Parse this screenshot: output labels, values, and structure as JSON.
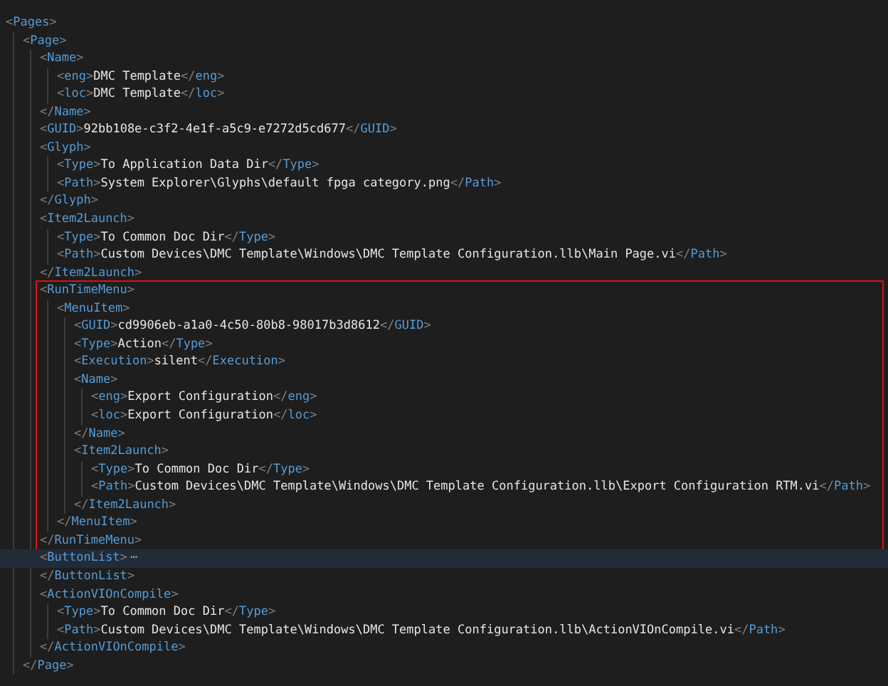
{
  "document": {
    "open": "<Pages>",
    "children": [
      {
        "open": "<Page>",
        "children": [
          {
            "open": "<Name>",
            "children": [
              {
                "open": "<eng>",
                "text": "DMC Template",
                "close": "</eng>"
              },
              {
                "open": "<loc>",
                "text": "DMC Template",
                "close": "</loc>"
              }
            ],
            "close": "</Name>"
          },
          {
            "open": "<GUID>",
            "text": "92bb108e-c3f2-4e1f-a5c9-e7272d5cd677",
            "close": "</GUID>"
          },
          {
            "open": "<Glyph>",
            "children": [
              {
                "open": "<Type>",
                "text": "To Application Data Dir",
                "close": "</Type>"
              },
              {
                "open": "<Path>",
                "text": "System Explorer\\Glyphs\\default fpga category.png",
                "close": "</Path>"
              }
            ],
            "close": "</Glyph>"
          },
          {
            "open": "<Item2Launch>",
            "children": [
              {
                "open": "<Type>",
                "text": "To Common Doc Dir",
                "close": "</Type>"
              },
              {
                "open": "<Path>",
                "text": "Custom Devices\\DMC Template\\Windows\\DMC Template Configuration.llb\\Main Page.vi",
                "close": "</Path>"
              }
            ],
            "close": "</Item2Launch>"
          },
          {
            "open": "<RunTimeMenu>",
            "boxed": true,
            "children": [
              {
                "open": "<MenuItem>",
                "children": [
                  {
                    "open": "<GUID>",
                    "text": "cd9906eb-a1a0-4c50-80b8-98017b3d8612",
                    "close": "</GUID>"
                  },
                  {
                    "open": "<Type>",
                    "text": "Action",
                    "close": "</Type>"
                  },
                  {
                    "open": "<Execution>",
                    "text": "silent",
                    "close": "</Execution>"
                  },
                  {
                    "open": "<Name>",
                    "children": [
                      {
                        "open": "<eng>",
                        "text": "Export Configuration",
                        "close": "</eng>"
                      },
                      {
                        "open": "<loc>",
                        "text": "Export Configuration",
                        "close": "</loc>"
                      }
                    ],
                    "close": "</Name>"
                  },
                  {
                    "open": "<Item2Launch>",
                    "children": [
                      {
                        "open": "<Type>",
                        "text": "To Common Doc Dir",
                        "close": "</Type>"
                      },
                      {
                        "open": "<Path>",
                        "text": "Custom Devices\\DMC Template\\Windows\\DMC Template Configuration.llb\\Export Configuration RTM.vi",
                        "close": "</Path>"
                      }
                    ],
                    "close": "</Item2Launch>"
                  }
                ],
                "close": "</MenuItem>"
              }
            ],
            "close": "</RunTimeMenu>"
          },
          {
            "open": "<ButtonList>",
            "collapsed": true,
            "current_line": true,
            "ellipsis": "⋯",
            "close": "</ButtonList>"
          },
          {
            "open": "<ActionVIOnCompile>",
            "children": [
              {
                "open": "<Type>",
                "text": "To Common Doc Dir",
                "close": "</Type>"
              },
              {
                "open": "<Path>",
                "text": "Custom Devices\\DMC Template\\Windows\\DMC Template Configuration.llb\\ActionVIOnCompile.vi",
                "close": "</Path>"
              }
            ],
            "close": "</ActionVIOnCompile>"
          }
        ],
        "close": "</Page>"
      }
    ]
  }
}
